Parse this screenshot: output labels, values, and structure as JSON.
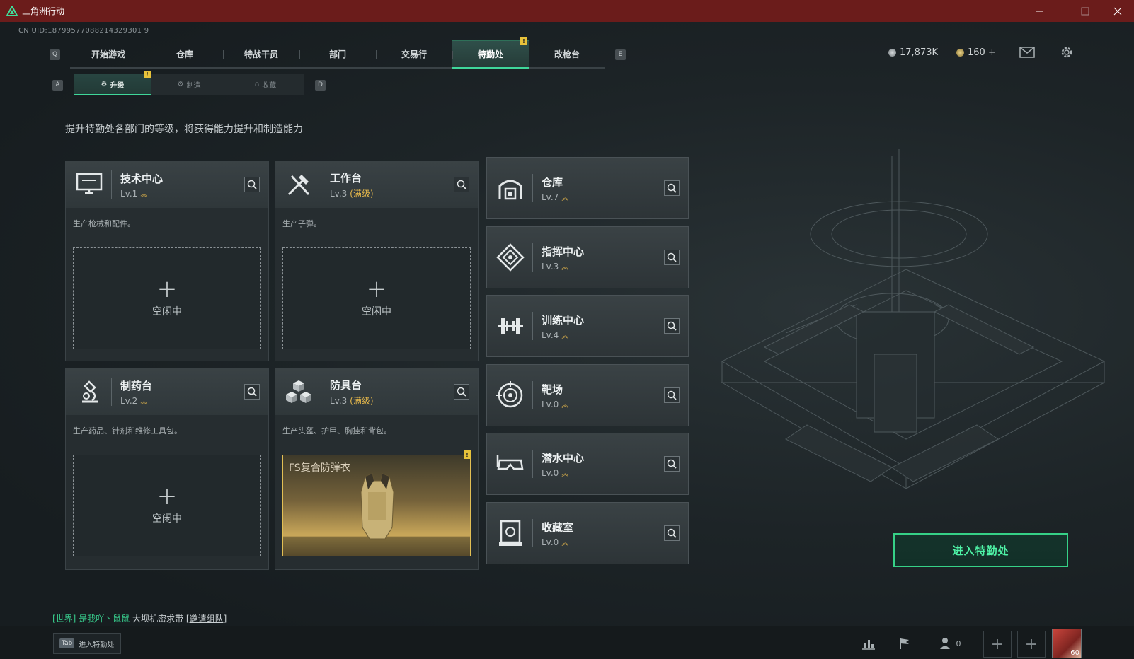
{
  "window": {
    "title": "三角洲行动"
  },
  "uid": "CN UID:18799577088214329301 9",
  "nav": {
    "left_key": "Q",
    "right_key": "E",
    "items": [
      "开始游戏",
      "仓库",
      "特战干员",
      "部门",
      "交易行",
      "特勤处",
      "改枪台"
    ],
    "active_index": 5,
    "badge": "!"
  },
  "currency": {
    "primary": "17,873K",
    "secondary": "160 +"
  },
  "subtabs": {
    "left_key": "A",
    "right_key": "D",
    "items": [
      "升级",
      "制造",
      "收藏"
    ],
    "badge": "!"
  },
  "description": "提升特勤处各部门的等级，将获得能力提升和制造能力",
  "cards": [
    {
      "name": "技术中心",
      "level": "Lv.1",
      "max": "",
      "desc": "生产枪械和配件。",
      "plus": "+",
      "idle": "空闲中"
    },
    {
      "name": "工作台",
      "level": "Lv.3",
      "max": "(满级)",
      "desc": "生产子弹。",
      "plus": "+",
      "idle": "空闲中"
    },
    {
      "name": "制药台",
      "level": "Lv.2",
      "max": "",
      "desc": "生产药品、针剂和维修工具包。",
      "plus": "+",
      "idle": "空闲中"
    },
    {
      "name": "防具台",
      "level": "Lv.3",
      "max": "(满级)",
      "desc": "生产头盔、护甲、胸挂和背包。",
      "item": "FS复合防弹衣",
      "badge": "!"
    }
  ],
  "departments": [
    {
      "name": "仓库",
      "level": "Lv.7"
    },
    {
      "name": "指挥中心",
      "level": "Lv.3"
    },
    {
      "name": "训练中心",
      "level": "Lv.4"
    },
    {
      "name": "靶场",
      "level": "Lv.0"
    },
    {
      "name": "潜水中心",
      "level": "Lv.0"
    },
    {
      "name": "收藏室",
      "level": "Lv.0"
    }
  ],
  "enter_button": "进入特勤处",
  "chat": {
    "channel": "[世界]",
    "sender": "是我吖丶鼠鼠",
    "message": "大坝机密求带",
    "invite": "[邀请组队]"
  },
  "bottom": {
    "tab_key": "Tab",
    "tab_label": "进入特勤处",
    "friends_count": "0",
    "avatar_level": "60"
  },
  "colors": {
    "accent": "#3fd79a",
    "gold": "#e3b64b",
    "titlebar": "#6b1c1b"
  }
}
